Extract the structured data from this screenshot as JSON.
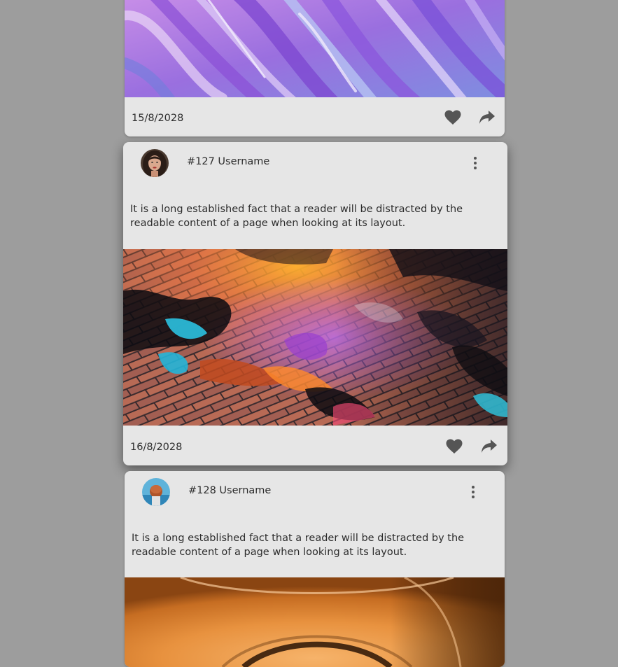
{
  "posts": [
    {
      "date": "15/8/2028",
      "image": "purple-marble-abstract"
    },
    {
      "username": "#127 Username",
      "text": "It is a long established fact that a reader will be distracted by the readable content of a page when looking at its layout.",
      "image": "wet-neon-pavement",
      "date": "16/8/2028"
    },
    {
      "username": "#128 Username",
      "text": "It is a long established fact that a reader will be distracted by the readable content of a page when looking at its layout.",
      "image": "orange-glow-abstract"
    }
  ],
  "icons": {
    "like": "heart-icon",
    "share": "share-icon",
    "menu": "more-vertical-icon"
  },
  "colors": {
    "page_background": "#9d9d9d",
    "card_background": "#e6e6e6",
    "icon_color": "#555555"
  }
}
